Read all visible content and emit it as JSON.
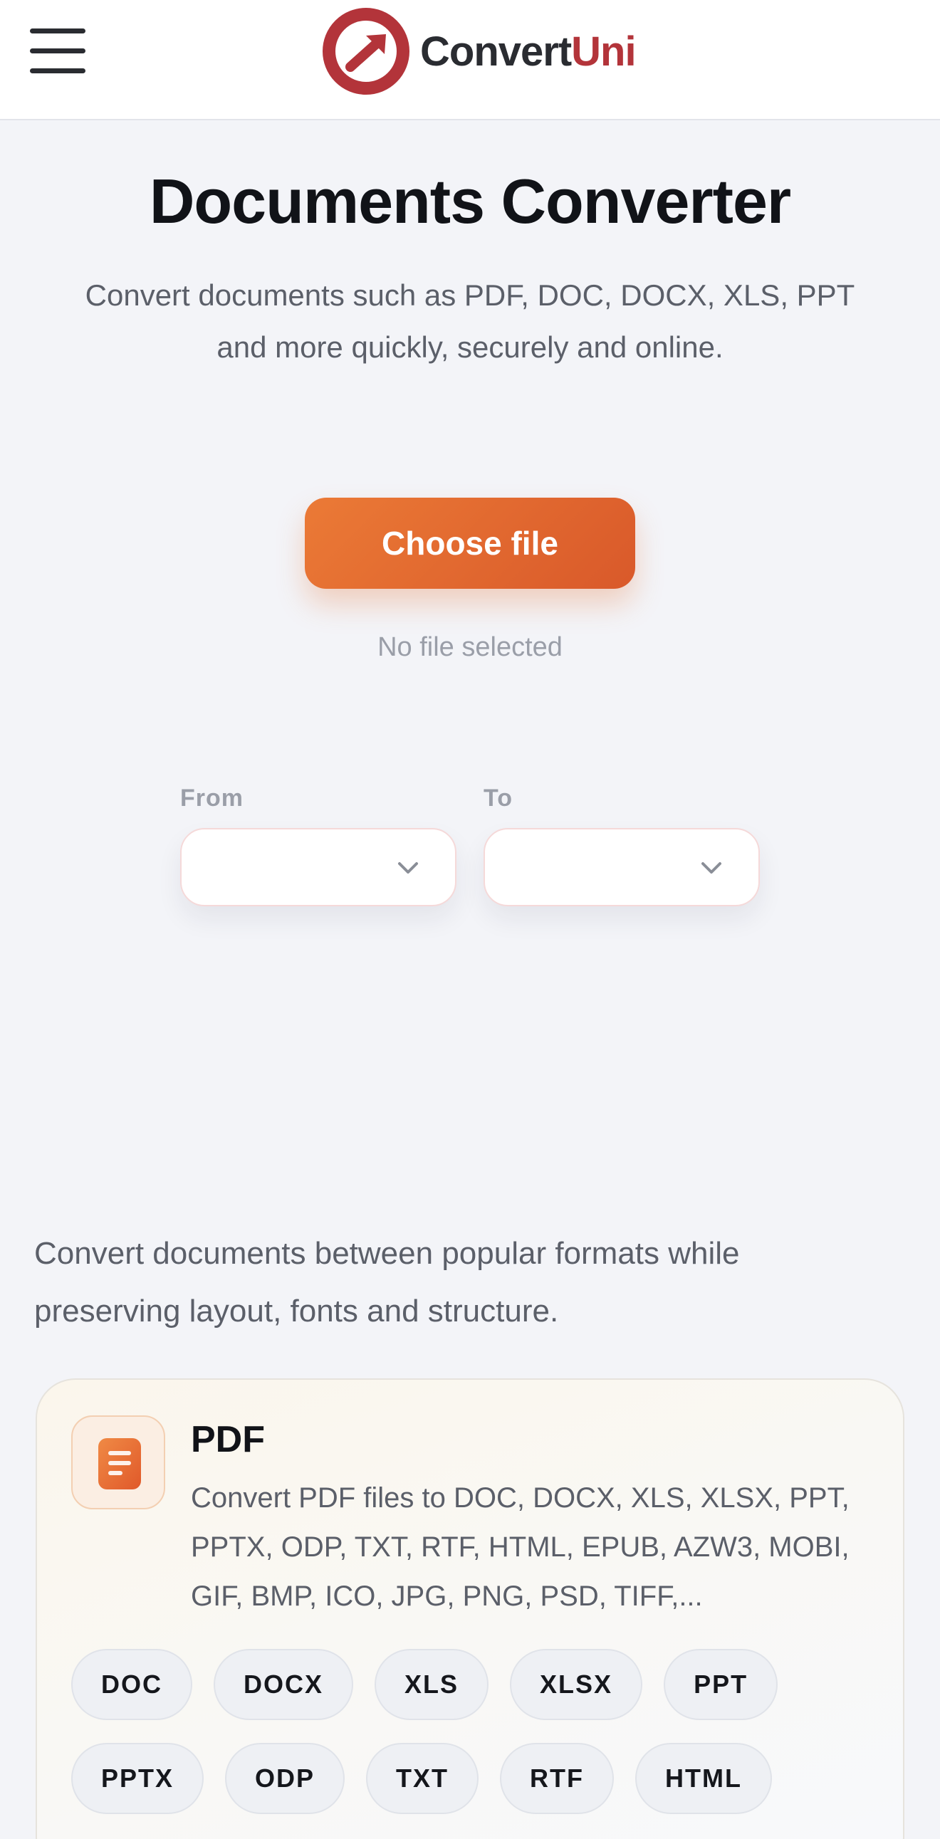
{
  "header": {
    "logo_word_1": "Convert",
    "logo_word_2": "Uni"
  },
  "hero": {
    "title": "Documents Converter",
    "subtitle": "Convert documents such as PDF, DOC, DOCX, XLS, PPT and more quickly, securely and online.",
    "choose_button": "Choose file",
    "file_status": "No file selected"
  },
  "converter": {
    "from_label": "From",
    "to_label": "To",
    "from_value": "",
    "to_value": ""
  },
  "intro": "Convert documents between popular formats while preserving layout, fonts and structure.",
  "cards": [
    {
      "title": "PDF",
      "description": "Convert PDF files to DOC, DOCX, XLS, XLSX, PPT, PPTX, ODP, TXT, RTF, HTML, EPUB, AZW3, MOBI, GIF, BMP, ICO, JPG, PNG, PSD, TIFF,...",
      "icon": "document-icon",
      "formats": [
        "DOC",
        "DOCX",
        "XLS",
        "XLSX",
        "PPT",
        "PPTX",
        "ODP",
        "TXT",
        "RTF",
        "HTML"
      ]
    }
  ],
  "colors": {
    "brand_red": "#b3343a",
    "accent_orange": "#e5692f",
    "background": "#f3f4f8"
  }
}
